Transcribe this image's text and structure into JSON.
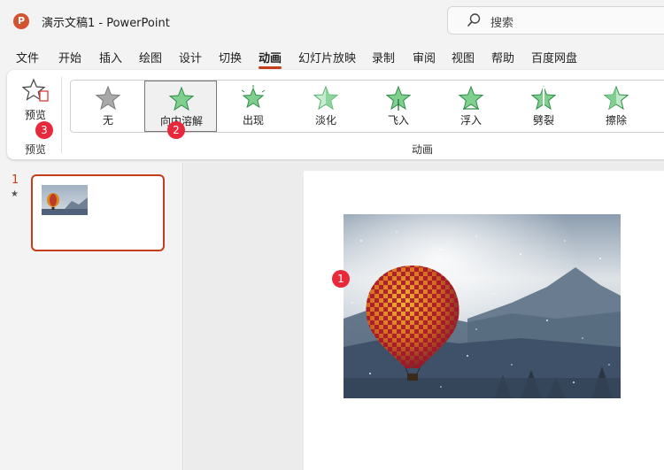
{
  "app": {
    "logo_letter": "P",
    "title": "演示文稿1  -  PowerPoint",
    "search_placeholder": "搜索"
  },
  "menu": {
    "tabs": [
      "文件",
      "开始",
      "插入",
      "绘图",
      "设计",
      "切换",
      "动画",
      "幻灯片放映",
      "录制",
      "审阅",
      "视图",
      "帮助",
      "百度网盘"
    ],
    "active": "动画"
  },
  "ribbon": {
    "preview_label": "预览",
    "preview_group": "预览",
    "animation_group": "动画",
    "animations": [
      {
        "label": "无",
        "icon": "star-none-icon",
        "color": "#9a9a9a"
      },
      {
        "label": "向内溶解",
        "icon": "star-dissolve-in-icon",
        "color": "#3aa655",
        "selected": true
      },
      {
        "label": "出现",
        "icon": "star-appear-icon",
        "color": "#3aa655"
      },
      {
        "label": "淡化",
        "icon": "star-fade-icon",
        "color": "#3aa655"
      },
      {
        "label": "飞入",
        "icon": "star-fly-in-icon",
        "color": "#3aa655"
      },
      {
        "label": "浮入",
        "icon": "star-float-in-icon",
        "color": "#3aa655"
      },
      {
        "label": "劈裂",
        "icon": "star-split-icon",
        "color": "#3aa655"
      },
      {
        "label": "擦除",
        "icon": "star-wipe-icon",
        "color": "#3aa655"
      }
    ]
  },
  "badges": {
    "slide_object": "1",
    "dissolve": "2",
    "preview": "3"
  },
  "slides": {
    "number": "1",
    "star": "★"
  },
  "colors": {
    "accent": "#c43e1c",
    "badge": "#e8293b",
    "star_green": "#3aa655"
  }
}
